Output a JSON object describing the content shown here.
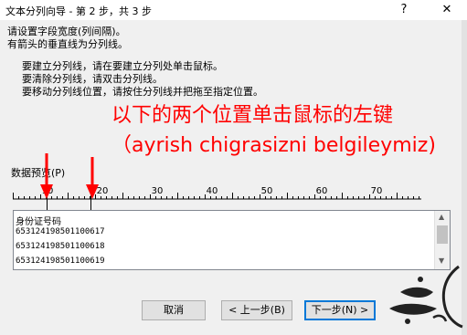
{
  "window": {
    "title": "文本分列向导 - 第 2 步，共 3 步",
    "help_symbol": "?",
    "close_symbol": "✕"
  },
  "intro": {
    "line1": "请设置字段宽度(列间隔)。",
    "line2": "有箭头的垂直线为分列线。"
  },
  "instructions": {
    "create": "要建立分列线，请在要建立分列处单击鼠标。",
    "delete": "要清除分列线，请双击分列线。",
    "move": "要移动分列线位置，请按住分列线并把拖至指定位置。"
  },
  "annotation": {
    "text": "以下的两个位置单击鼠标的左键（ayrish  chigrasizni belgileymiz)",
    "color": "#ff0000"
  },
  "preview": {
    "label": "数据预览(P)",
    "ruler_labels": [
      "10",
      "20",
      "30",
      "40",
      "50",
      "60",
      "70"
    ],
    "lines": [
      "身份证号码",
      "653124198501100617",
      "653124198501100618",
      "653124198501100619"
    ],
    "break_columns": [
      6,
      14
    ]
  },
  "buttons": {
    "cancel": "取消",
    "back": "< 上一步(B)",
    "next": "下一步(N) >"
  },
  "icons": {
    "annotation_arrow": "red-arrow-icon",
    "scroll_up": "scroll-up-icon",
    "scroll_down": "scroll-down-icon",
    "watermark": "watermark-logo"
  }
}
